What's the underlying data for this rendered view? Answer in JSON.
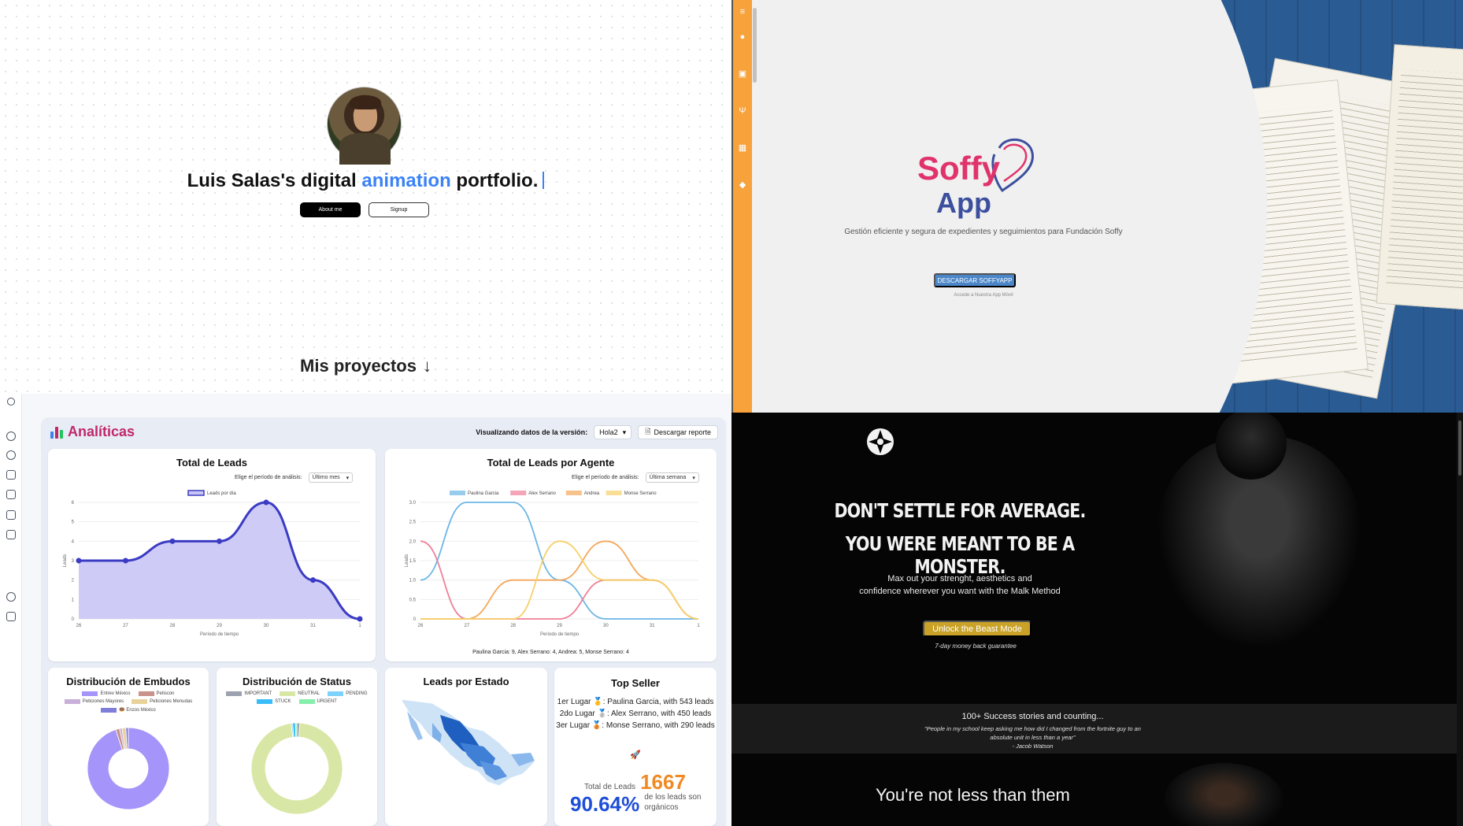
{
  "portfolio": {
    "title_part1": "Luis Salas's digital ",
    "title_accent": "animation",
    "title_part2": " portfolio.",
    "about_label": "About me",
    "signup_label": "Signup",
    "projects_title": "Mis proyectos",
    "projects_arrow": "↓"
  },
  "analytics": {
    "title": "Analíticas",
    "version_label": "Visualizando datos de la versión:",
    "version_value": "Hola2",
    "download_label": "Descargar reporte",
    "colors": {
      "accent": "#c0286a",
      "primary_line": "#3b3bc4",
      "fill": "#c9c6f5"
    },
    "leads": {
      "title": "Total de Leads",
      "filter_label": "Elige el período de análisis:",
      "filter_value": "Último mes",
      "legend": "Leads por día",
      "ylabel": "Leads",
      "xlabel": "Período de tiempo"
    },
    "agents": {
      "title": "Total de Leads por Agente",
      "filter_label": "Elige el período de análisis:",
      "filter_value": "Última semana",
      "ylabel": "Leads",
      "xlabel": "Período de tiempo",
      "summary": "Paulina Garcia: 9, Alex Serrano: 4, Andrea: 5, Monse Serrano: 4",
      "legend": [
        {
          "name": "Paulina Garcia",
          "color": "#6cb6e6"
        },
        {
          "name": "Alex Serrano",
          "color": "#ef7f98"
        },
        {
          "name": "Andrea",
          "color": "#f4a75a"
        },
        {
          "name": "Monse Serrano",
          "color": "#f5d06a"
        }
      ]
    },
    "embudos": {
      "title": "Distribución de Embudos",
      "legend": [
        {
          "name": "Entrev México",
          "color": "#a594f9"
        },
        {
          "name": "Petiscon",
          "color": "#c9928a"
        },
        {
          "name": "Peticiones Mayores",
          "color": "#c8b0d8"
        },
        {
          "name": "Peticiones Menudas",
          "color": "#e9d29a"
        },
        {
          "name": "🍩 Enzos México",
          "color": "#7f7fd9"
        }
      ]
    },
    "status": {
      "title": "Distribución de Status",
      "legend": [
        {
          "name": "IMPORTANT",
          "color": "#9ca3af"
        },
        {
          "name": "NEUTRAL",
          "color": "#d9e7a6"
        },
        {
          "name": "PENDING",
          "color": "#7dd3fc"
        },
        {
          "name": "STUCK",
          "color": "#38bdf8"
        },
        {
          "name": "URGENT",
          "color": "#86efac"
        }
      ]
    },
    "estado": {
      "title": "Leads por Estado"
    },
    "top_seller": {
      "title": "Top Seller",
      "lines": [
        "1er Lugar 🥇: Paulina Garcia, with 543 leads",
        "2do Lugar 🥈: Alex Serrano, with 450 leads",
        "3er Lugar 🥉: Monse Serrano, with 290 leads"
      ],
      "total_label": "Total de Leads",
      "total_value": "1667",
      "pct_value": "90.64%",
      "pct_label": "de los leads son orgánicos"
    }
  },
  "chart_data": [
    {
      "type": "area",
      "title": "Total de Leads",
      "xlabel": "Período de tiempo",
      "ylabel": "Leads",
      "x": [
        "26",
        "27",
        "28",
        "29",
        "30",
        "31",
        "1"
      ],
      "series": [
        {
          "name": "Leads por día",
          "values": [
            3,
            3,
            4,
            4,
            6,
            2,
            0
          ]
        }
      ],
      "ylim": [
        0,
        6
      ],
      "yticks": [
        "0",
        "1",
        "2",
        "3",
        "4",
        "5",
        "6"
      ]
    },
    {
      "type": "line",
      "title": "Total de Leads por Agente",
      "xlabel": "Período de tiempo",
      "ylabel": "Leads",
      "x": [
        "26",
        "27",
        "28",
        "29",
        "30",
        "31",
        "1"
      ],
      "ylim": [
        0,
        3
      ],
      "yticks": [
        "0",
        "0.5",
        "1.0",
        "1.5",
        "2.0",
        "2.5",
        "3.0"
      ],
      "series": [
        {
          "name": "Paulina Garcia",
          "values": [
            1,
            3,
            3,
            1,
            0,
            0,
            0
          ]
        },
        {
          "name": "Alex Serrano",
          "values": [
            2,
            0,
            0,
            0,
            1,
            1,
            0
          ]
        },
        {
          "name": "Andrea",
          "values": [
            0,
            0,
            1,
            1,
            2,
            1,
            0
          ]
        },
        {
          "name": "Monse Serrano",
          "values": [
            0,
            0,
            0,
            2,
            1,
            1,
            0
          ]
        }
      ]
    },
    {
      "type": "pie",
      "title": "Distribución de Embudos",
      "categories": [
        "Entrev México",
        "Petiscon",
        "Peticiones Mayores",
        "Peticiones Menudas",
        "🍩 Enzos México"
      ],
      "values": [
        95,
        1.5,
        1,
        1.5,
        1
      ]
    },
    {
      "type": "pie",
      "title": "Distribución de Status",
      "categories": [
        "IMPORTANT",
        "NEUTRAL",
        "PENDING",
        "STUCK",
        "URGENT"
      ],
      "values": [
        1,
        97,
        0.5,
        1,
        0.5
      ]
    }
  ],
  "soffy": {
    "logo_top": "Soffy",
    "logo_bottom": "App",
    "tagline": "Gestión eficiente y segura de expedientes y seguimientos para Fundación Soffy",
    "download_label": "DESCARGAR SOFFYAPP",
    "sub_label": "Accede a Nuestra App Móvil",
    "colors": {
      "sidebar": "#f7a23b",
      "logo_pink": "#e0336b",
      "logo_blue": "#3c4f9e",
      "button": "#4a86c8"
    }
  },
  "fitness": {
    "headline1": "DON'T SETTLE FOR AVERAGE.",
    "headline2": "YOU WERE MEANT TO BE A MONSTER.",
    "body1": "Max out your strenght, aesthetics and",
    "body2": "confidence wherever you want with the Malk Method",
    "cta": "Unlock the Beast Mode",
    "guarantee": "7-day money back guarantee",
    "stories": "100+ Success stories and counting...",
    "quote1": "\"People in my school keep asking me how did I changed from the fortnite guy to an",
    "quote2": "absolute unit in less than a year\"",
    "quote_author": "- Jacob Watson",
    "not_less": "You're not less than them",
    "colors": {
      "cta": "#c9a227"
    }
  }
}
